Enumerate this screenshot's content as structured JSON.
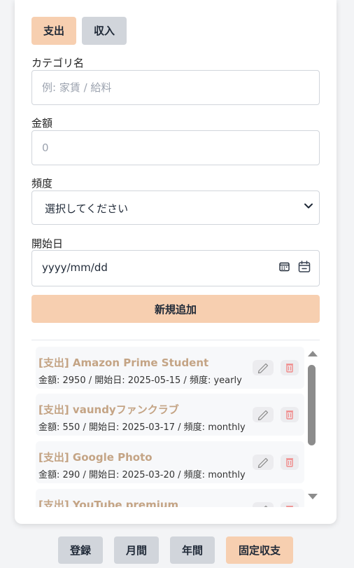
{
  "tabs": {
    "expense": "支出",
    "income": "収入"
  },
  "form": {
    "category_label": "カテゴリ名",
    "category_placeholder": "例: 家賃 / 給料",
    "amount_label": "金額",
    "amount_placeholder": "0",
    "frequency_label": "頻度",
    "frequency_selected": "選択してください",
    "start_label": "開始日",
    "start_placeholder": "yyyy/mm/dd",
    "add_button": "新規追加"
  },
  "entries": [
    {
      "title": "[支出] Amazon Prime Student",
      "detail": "金額: 2950 / 開始日: 2025-05-15 / 頻度: yearly"
    },
    {
      "title": "[支出] vaundyファンクラブ",
      "detail": "金額: 550 / 開始日: 2025-03-17 / 頻度: monthly"
    },
    {
      "title": "[支出] Google Photo",
      "detail": "金額: 290 / 開始日: 2025-03-20 / 頻度: monthly"
    },
    {
      "title": "[支出] YouTube premium",
      "detail": ""
    }
  ],
  "nav": {
    "register": "登録",
    "monthly": "月間",
    "yearly": "年間",
    "fixed": "固定収支"
  },
  "icons": {
    "edit": "pencil-icon",
    "delete": "trash-icon",
    "calendar": "calendar-icon",
    "dropdown": "chevron-down-icon"
  },
  "colors": {
    "accent": "#f7cfb0",
    "inactive": "#d1d5db",
    "entry_title": "#c4a485",
    "delete_icon": "#f08a8a"
  }
}
